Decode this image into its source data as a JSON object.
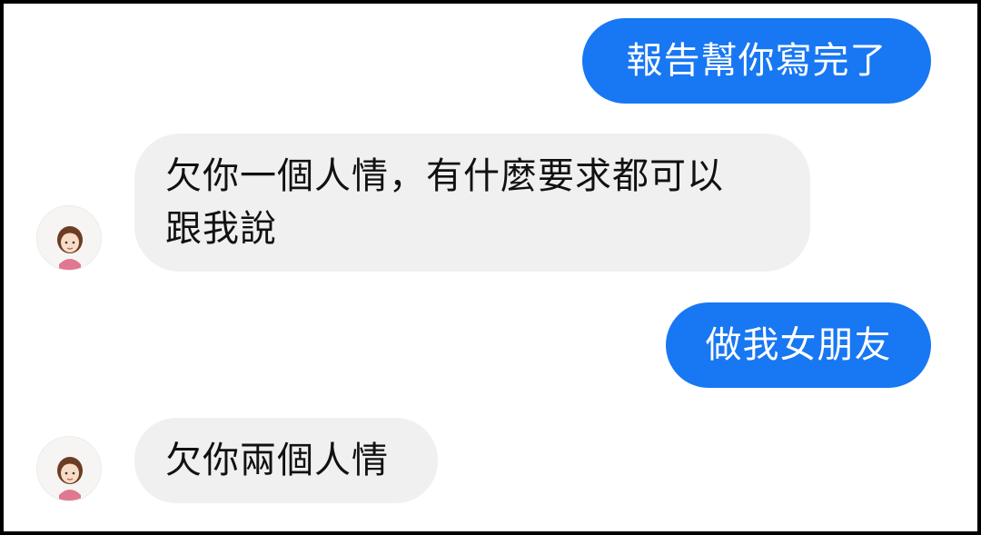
{
  "chat": {
    "messages": [
      {
        "sender": "me",
        "text": "報告幫你寫完了"
      },
      {
        "sender": "contact",
        "text": "欠你一個人情，有什麼要求都可以\n跟我說"
      },
      {
        "sender": "me",
        "text": "做我女朋友"
      },
      {
        "sender": "contact",
        "text": "欠你兩個人情"
      }
    ]
  },
  "colors": {
    "outgoing_bubble": "#1877f2",
    "incoming_bubble": "#f0f0f0",
    "background": "#ffffff"
  },
  "icons": {
    "contact_avatar": "girl-avatar-icon"
  }
}
